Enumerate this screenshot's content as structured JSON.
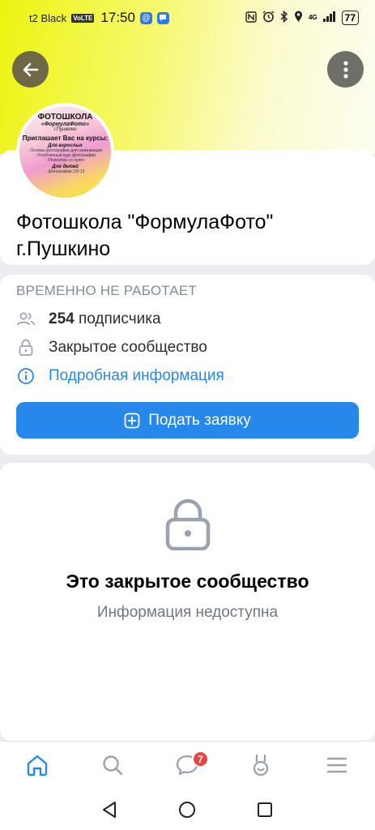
{
  "status_bar": {
    "carrier": "t2 Black",
    "volte": "VoLTE",
    "time": "17:50",
    "network": "4G",
    "battery": "77"
  },
  "avatar_text": {
    "line1": "ФОТОШКОЛА",
    "line2": "«ФормулаФото»",
    "line3": "г.Пушкино",
    "line4": "Приглашает Вас на курсы:",
    "line5": "Для взрослых",
    "line6": "- Основы фотографии для начинающих",
    "line7": "- Углублённый курс фотографии",
    "line8": "- Photoshop «с нуля»",
    "line9": "Для детей",
    "line10": "- фотографии (10-13"
  },
  "group": {
    "title": "Фотошкола \"ФормулаФото\" г.Пушкино",
    "status": "ВРЕМЕННО НЕ РАБОТАЕТ",
    "subscribers_count": "254",
    "subscribers_word": "подписчика",
    "closed_label": "Закрытое сообщество",
    "details_link": "Подробная информация",
    "apply_button": "Подать заявку"
  },
  "closed_notice": {
    "title": "Это закрытое сообщество",
    "subtitle": "Информация недоступна"
  },
  "tab_bar": {
    "messages_badge": "7"
  },
  "colors": {
    "accent": "#2688eb",
    "badge": "#e64646",
    "secondary_text": "#818c99"
  }
}
